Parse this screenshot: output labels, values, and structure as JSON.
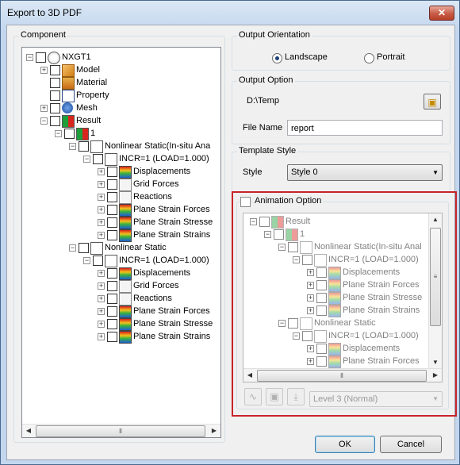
{
  "window": {
    "title": "Export to 3D PDF",
    "close_glyph": "✕"
  },
  "component": {
    "label": "Component",
    "tree": [
      {
        "label": "NXGT1",
        "exp": "−",
        "icon": "compass"
      },
      {
        "label": "Model",
        "exp": "+",
        "icon": "cube"
      },
      {
        "label": "Material",
        "exp": "",
        "icon": "material"
      },
      {
        "label": "Property",
        "exp": "",
        "icon": "property"
      },
      {
        "label": "Mesh",
        "exp": "+",
        "icon": "mesh"
      },
      {
        "label": "Result",
        "exp": "−",
        "icon": "result"
      },
      {
        "label": "1",
        "exp": "−",
        "icon": "result"
      },
      {
        "label": "Nonlinear Static(In-situ Ana",
        "exp": "−",
        "icon": "analysis"
      },
      {
        "label": "INCR=1 (LOAD=1.000)",
        "exp": "−",
        "icon": "analysis"
      },
      {
        "label": "Displacements",
        "exp": "+",
        "icon": "contour"
      },
      {
        "label": "Grid Forces",
        "exp": "+",
        "icon": "forces"
      },
      {
        "label": "Reactions",
        "exp": "+",
        "icon": "forces"
      },
      {
        "label": "Plane Strain Forces",
        "exp": "+",
        "icon": "contour"
      },
      {
        "label": "Plane Strain Stresse",
        "exp": "+",
        "icon": "contour"
      },
      {
        "label": "Plane Strain Strains",
        "exp": "+",
        "icon": "contour"
      },
      {
        "label": "Nonlinear Static",
        "exp": "−",
        "icon": "analysis"
      },
      {
        "label": "INCR=1 (LOAD=1.000)",
        "exp": "−",
        "icon": "analysis"
      },
      {
        "label": "Displacements",
        "exp": "+",
        "icon": "contour"
      },
      {
        "label": "Grid Forces",
        "exp": "+",
        "icon": "forces"
      },
      {
        "label": "Reactions",
        "exp": "+",
        "icon": "forces"
      },
      {
        "label": "Plane Strain Forces",
        "exp": "+",
        "icon": "contour"
      },
      {
        "label": "Plane Strain Stresse",
        "exp": "+",
        "icon": "contour"
      },
      {
        "label": "Plane Strain Strains",
        "exp": "+",
        "icon": "contour"
      }
    ],
    "scroll_thumb": "⦀"
  },
  "orientation": {
    "label": "Output Orientation",
    "landscape": "Landscape",
    "portrait": "Portrait",
    "selected": "Landscape"
  },
  "output": {
    "label": "Output Option",
    "folder": "D:\\Temp",
    "file_name_label": "File Name",
    "file_name": "report"
  },
  "template": {
    "label": "Template Style",
    "style_label": "Style",
    "style_value": "Style 0"
  },
  "animation": {
    "label": "Animation Option",
    "checked": false,
    "tree": [
      {
        "label": "Result",
        "exp": "−",
        "icon": "result"
      },
      {
        "label": "1",
        "exp": "−",
        "icon": "result"
      },
      {
        "label": "Nonlinear Static(In-situ Anal",
        "exp": "−",
        "icon": "analysis"
      },
      {
        "label": "INCR=1 (LOAD=1.000)",
        "exp": "−",
        "icon": "analysis"
      },
      {
        "label": "Displacements",
        "exp": "+",
        "icon": "contour"
      },
      {
        "label": "Plane Strain Forces",
        "exp": "+",
        "icon": "contour"
      },
      {
        "label": "Plane Strain Stresse",
        "exp": "+",
        "icon": "contour"
      },
      {
        "label": "Plane Strain Strains",
        "exp": "+",
        "icon": "contour"
      },
      {
        "label": "Nonlinear Static",
        "exp": "−",
        "icon": "analysis"
      },
      {
        "label": "INCR=1 (LOAD=1.000)",
        "exp": "−",
        "icon": "analysis"
      },
      {
        "label": "Displacements",
        "exp": "+",
        "icon": "contour"
      },
      {
        "label": "Plane Strain Forces",
        "exp": "+",
        "icon": "contour"
      }
    ],
    "level": "Level 3 (Normal)"
  },
  "buttons": {
    "ok": "OK",
    "cancel": "Cancel"
  },
  "colors": {
    "highlight_frame": "#c8232a",
    "accent": "#3c7fb1"
  }
}
